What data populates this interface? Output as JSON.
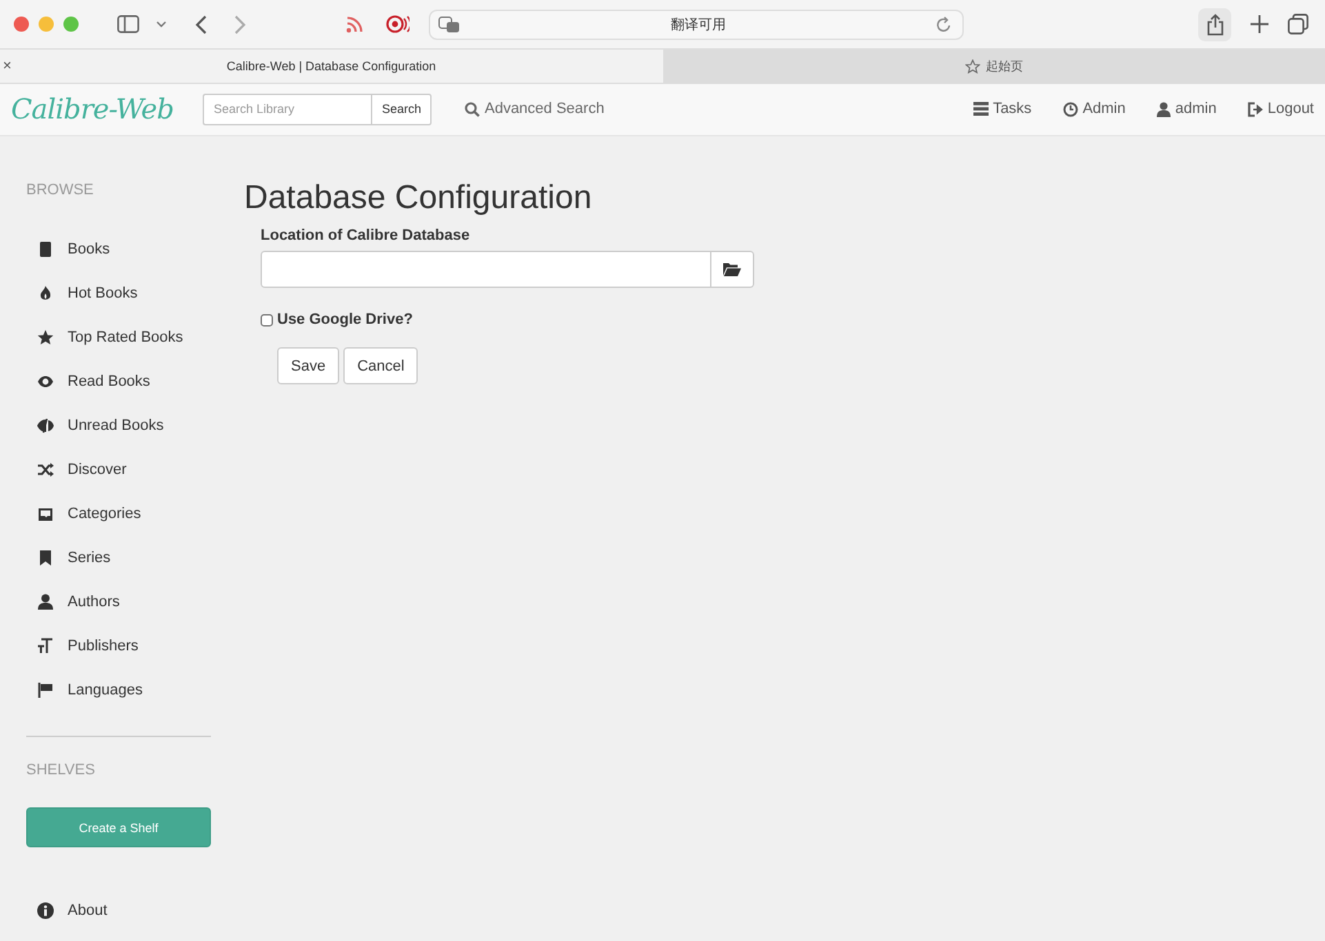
{
  "browser": {
    "address": "翻译可用",
    "close_mark": "×",
    "tabs": [
      {
        "label": "Calibre-Web | Database Configuration",
        "selected": true
      },
      {
        "label": "起始页",
        "selected": false
      }
    ]
  },
  "navbar": {
    "brand": "Calibre-Web",
    "search": {
      "placeholder": "Search Library",
      "button": "Search"
    },
    "advanced_search": "Advanced Search",
    "links": [
      "Tasks",
      "Admin",
      "admin",
      "Logout"
    ]
  },
  "sidebar": {
    "browse_heading": "BROWSE",
    "items": [
      {
        "label": "Books"
      },
      {
        "label": "Hot Books"
      },
      {
        "label": "Top Rated Books"
      },
      {
        "label": "Read Books"
      },
      {
        "label": "Unread Books"
      },
      {
        "label": "Discover"
      },
      {
        "label": "Categories"
      },
      {
        "label": "Series"
      },
      {
        "label": "Authors"
      },
      {
        "label": "Publishers"
      },
      {
        "label": "Languages"
      }
    ],
    "shelves_heading": "SHELVES",
    "create_shelf": "Create a Shelf",
    "about": "About"
  },
  "form": {
    "title": "Database Configuration",
    "location_label": "Location of Calibre Database",
    "use_google_drive": {
      "label": "Use Google Drive?",
      "checked": false
    },
    "buttons": [
      "Save",
      "Cancel"
    ]
  }
}
